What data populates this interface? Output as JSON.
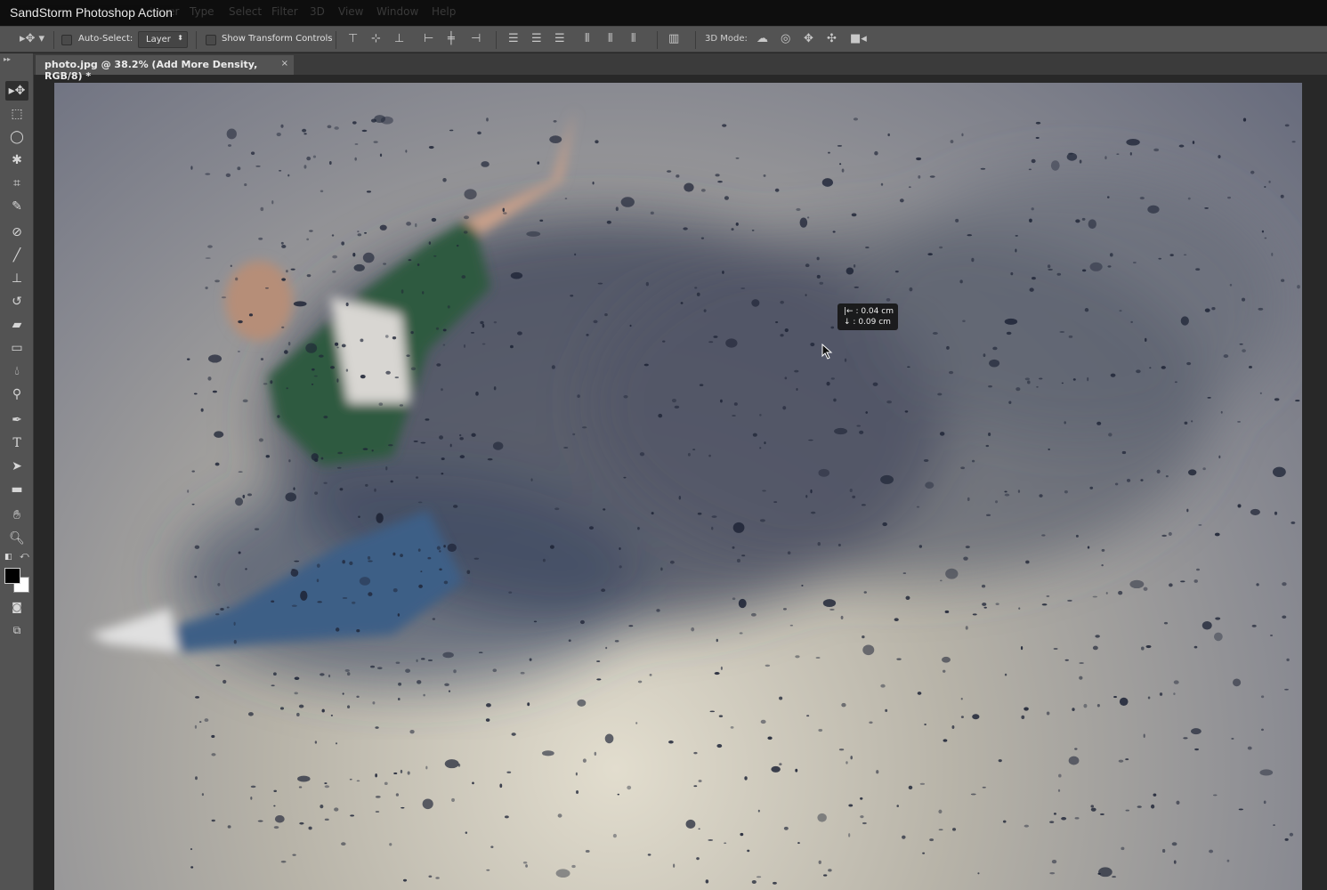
{
  "app_title": "SandStorm Photoshop Action",
  "menu": [
    "Layer",
    "Type",
    "Select",
    "Filter",
    "3D",
    "View",
    "Window",
    "Help"
  ],
  "options": {
    "auto_select_label": "Auto-Select:",
    "auto_select_checked": false,
    "layer_select": "Layer",
    "show_transform_label": "Show Transform Controls",
    "show_transform_checked": false,
    "mode_3d_label": "3D Mode:"
  },
  "document_tab": {
    "title": "photo.jpg @ 38.2% (Add More Density, RGB/8) *",
    "close": "×"
  },
  "tools": [
    "move",
    "rectangular-marquee",
    "lasso",
    "magic-wand",
    "crop",
    "eyedropper",
    "spot-healing-brush",
    "brush",
    "clone-stamp",
    "history-brush",
    "eraser",
    "gradient",
    "blur",
    "dodge",
    "pen",
    "type",
    "path-selection",
    "rectangle",
    "hand",
    "zoom"
  ],
  "colors": {
    "foreground": "#000000",
    "background": "#ffffff"
  },
  "tooltip": {
    "dx": "0.04 cm",
    "dy": "0.09 cm",
    "dx_icon": "|←",
    "dy_icon": "↓"
  }
}
